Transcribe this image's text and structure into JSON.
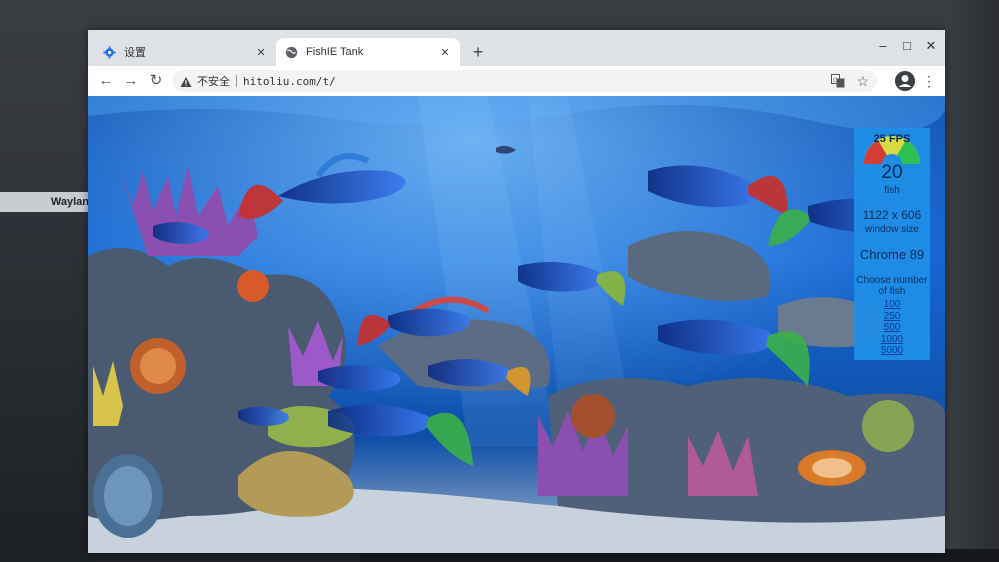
{
  "background": {
    "side_label": "Waylan"
  },
  "tabs": [
    {
      "title": "设置",
      "icon": "gear-icon",
      "active": false
    },
    {
      "title": "FishIE Tank",
      "icon": "globe-icon",
      "active": true
    }
  ],
  "new_tab_label": "+",
  "window_controls": {
    "minimize": "–",
    "maximize": "□",
    "close": "✕"
  },
  "toolbar": {
    "back": "←",
    "forward": "→",
    "reload": "↻",
    "security_label": "不安全",
    "url": "hitoliu.com/t/",
    "star": "☆",
    "menu": "⋮"
  },
  "panel": {
    "fps": "25 FPS",
    "fish_count": "20",
    "fish_label": "fish",
    "window_size": "1122 x 606",
    "window_size_label": "window size",
    "browser": "Chrome 89",
    "choose_label": "Choose number of fish",
    "options": [
      "100",
      "250",
      "500",
      "1000",
      "5000"
    ]
  },
  "colors": {
    "accent": "#1f8fe8",
    "water_top": "#0a3f8f",
    "water_mid": "#1a6fd8",
    "sand": "#b9c7d4"
  }
}
